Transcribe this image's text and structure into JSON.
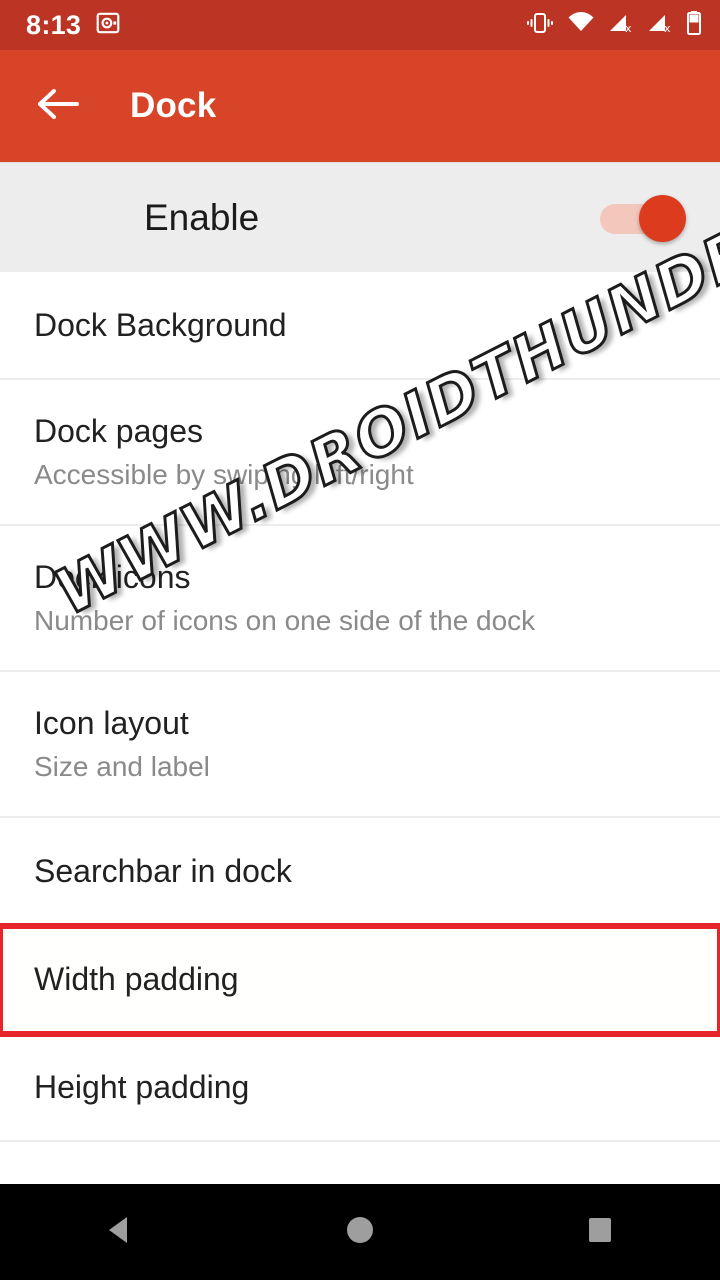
{
  "status_bar": {
    "time": "8:13",
    "icons": [
      {
        "name": "safe-icon",
        "position": "left"
      },
      {
        "name": "vibrate-icon",
        "position": "right"
      },
      {
        "name": "wifi-icon",
        "position": "right"
      },
      {
        "name": "signal-no-sim-1-icon",
        "position": "right"
      },
      {
        "name": "signal-no-sim-2-icon",
        "position": "right"
      },
      {
        "name": "battery-icon",
        "position": "right"
      }
    ],
    "background_color": "#BC3424"
  },
  "app_bar": {
    "back_icon": "arrow-left-icon",
    "title": "Dock",
    "background_color": "#D84427",
    "text_color": "#FFFFFF"
  },
  "enable": {
    "label": "Enable",
    "switch_on": true,
    "track_color": "#F3C7BC",
    "thumb_color": "#DD3B1E",
    "row_background": "#EDEDED"
  },
  "settings": {
    "items": [
      {
        "title": "Dock Background",
        "subtitle": "",
        "highlighted": false
      },
      {
        "title": "Dock pages",
        "subtitle": "Accessible by swiping left/right",
        "highlighted": false
      },
      {
        "title": "Dock icons",
        "subtitle": "Number of icons on one side of the dock",
        "highlighted": false
      },
      {
        "title": "Icon layout",
        "subtitle": "Size and label",
        "highlighted": false
      },
      {
        "title": "Searchbar in dock",
        "subtitle": "",
        "highlighted": false
      },
      {
        "title": "Width padding",
        "subtitle": "",
        "highlighted": true
      },
      {
        "title": "Height padding",
        "subtitle": "",
        "highlighted": false
      }
    ],
    "highlight_color": "#E8242B"
  },
  "watermark": {
    "text": "WWW.DROIDTHUNDER.COM"
  },
  "nav_bar": {
    "background_color": "#000000",
    "buttons": [
      {
        "name": "back-nav-button",
        "icon": "triangle-left-icon"
      },
      {
        "name": "home-nav-button",
        "icon": "circle-icon"
      },
      {
        "name": "recents-nav-button",
        "icon": "square-icon"
      }
    ]
  }
}
